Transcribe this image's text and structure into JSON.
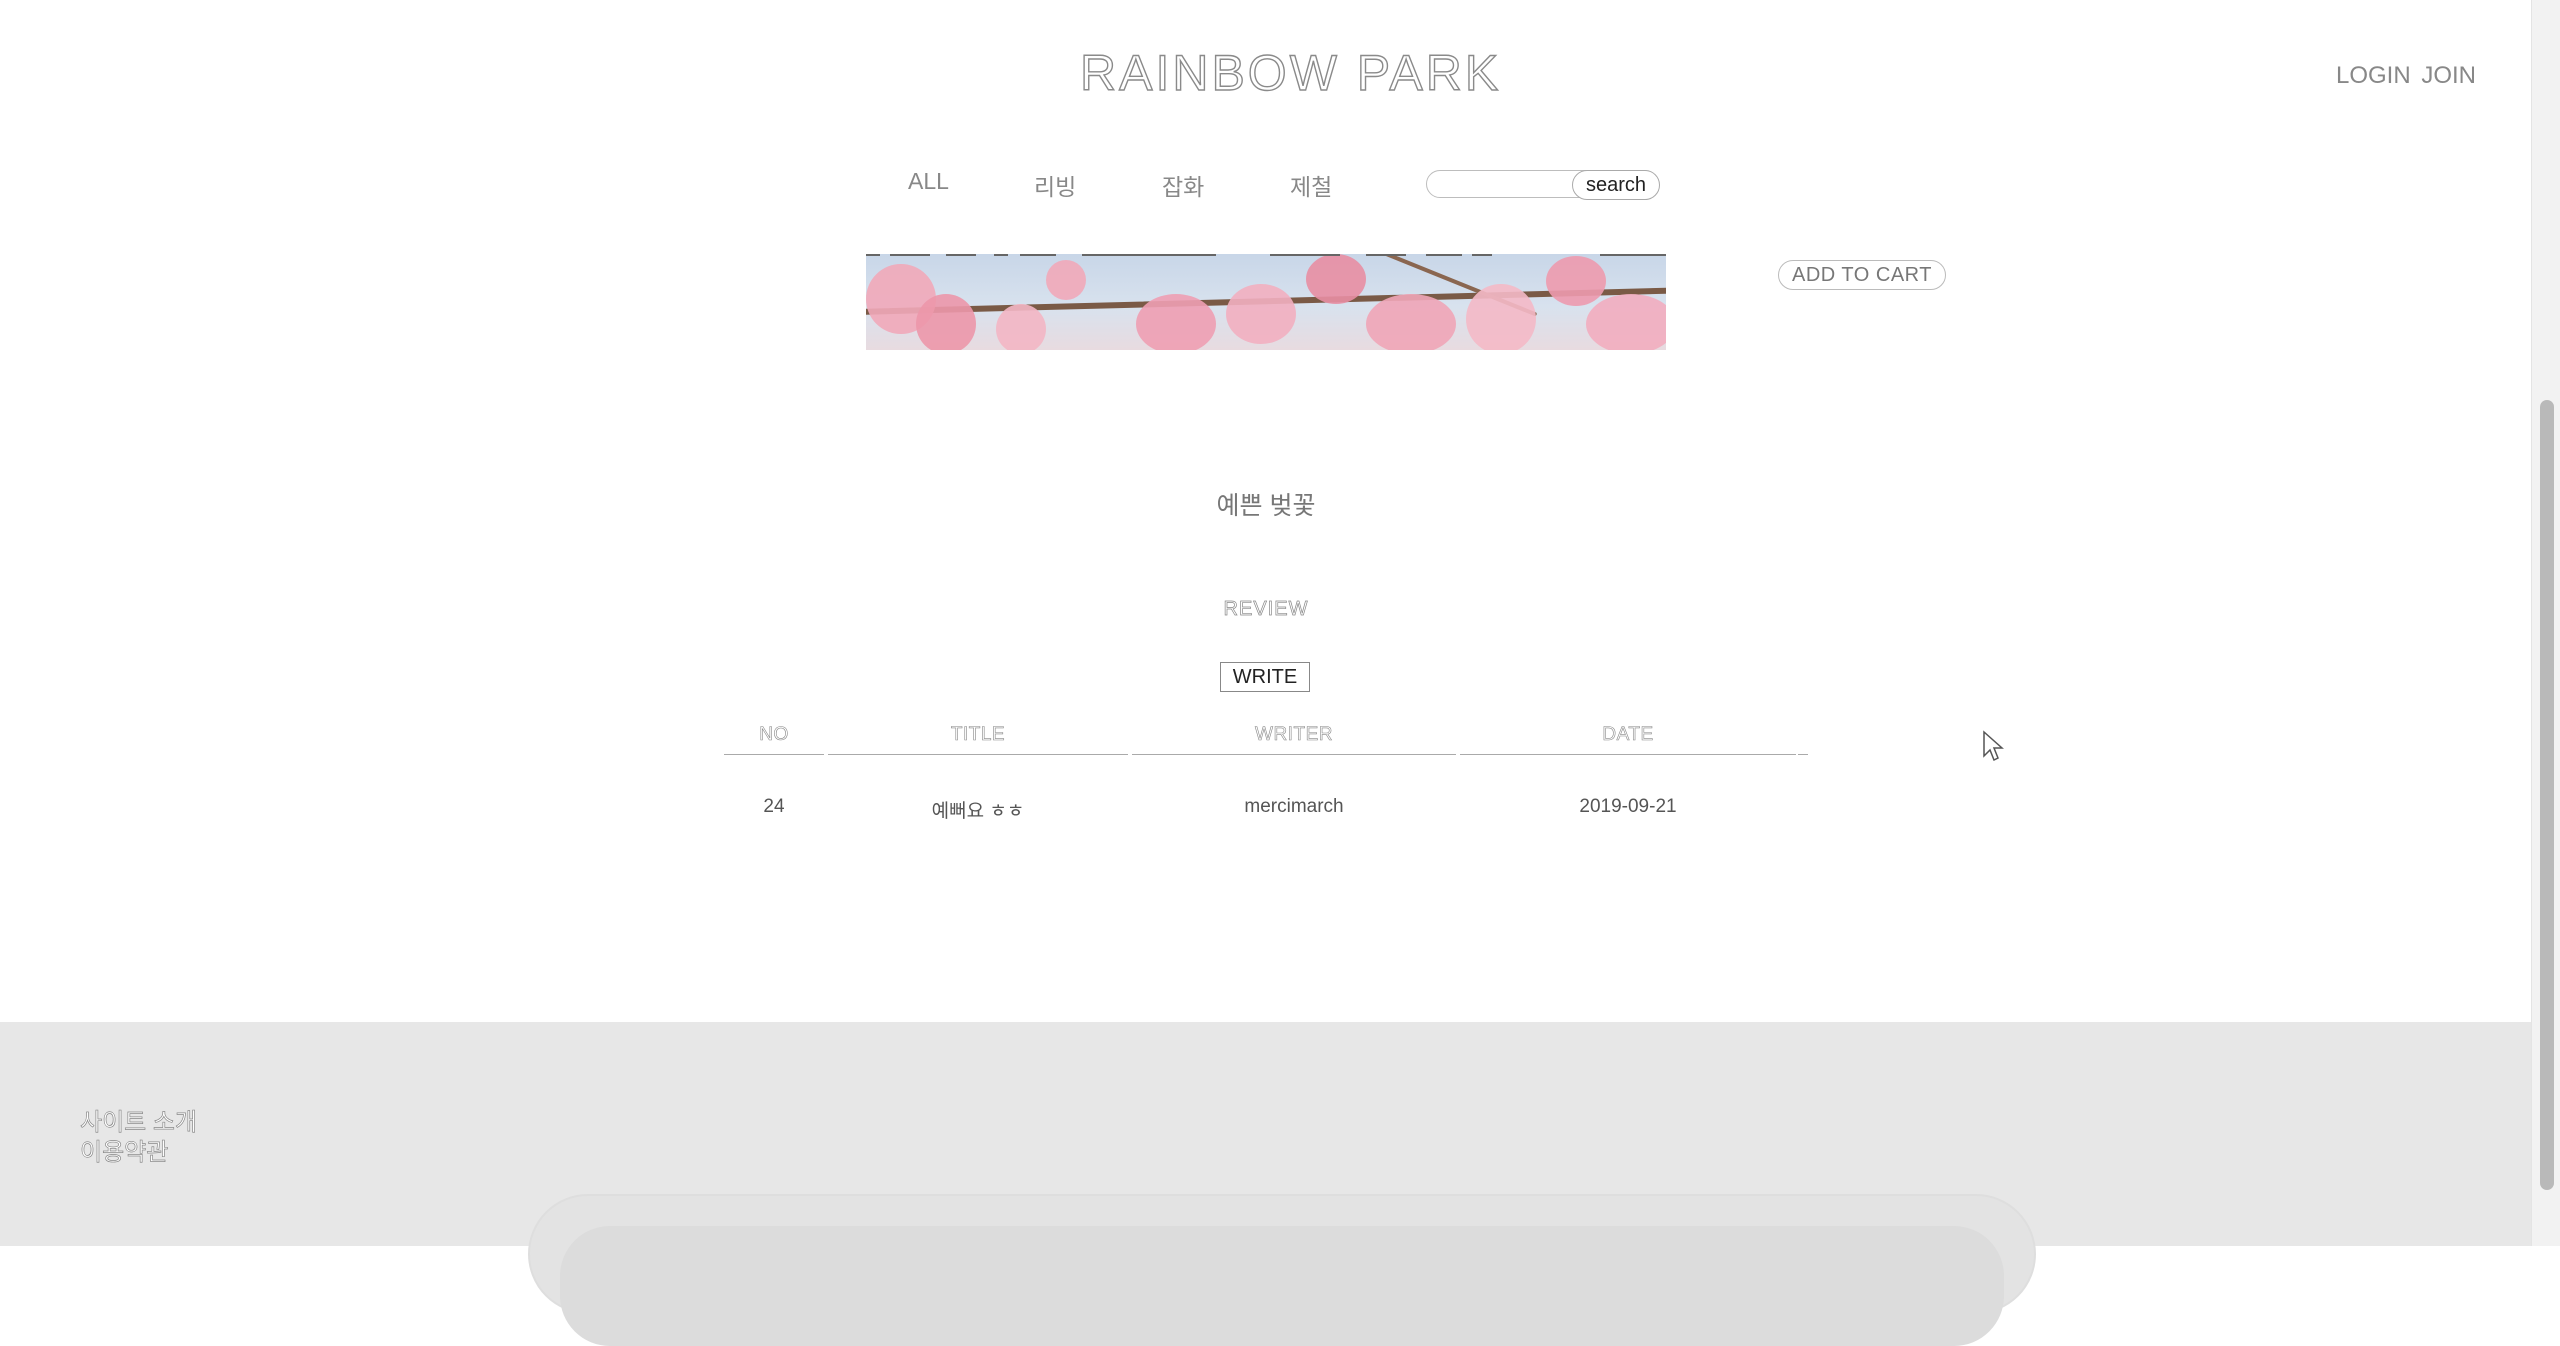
{
  "header": {
    "logo": "RAINBOW PARK",
    "login": "LOGIN",
    "join": "JOIN"
  },
  "nav": {
    "items": [
      {
        "label": "ALL"
      },
      {
        "label": "리빙"
      },
      {
        "label": "잡화"
      },
      {
        "label": "제철"
      }
    ],
    "search": {
      "value": "",
      "placeholder": "",
      "button_label": "search"
    }
  },
  "product": {
    "add_to_cart_label": "ADD TO CART",
    "name": "예쁜 벚꽃"
  },
  "review": {
    "title": "REVIEW",
    "write_label": "WRITE",
    "columns": [
      "NO",
      "TITLE",
      "WRITER",
      "DATE"
    ],
    "rows": [
      {
        "no": "24",
        "title": "예뻐요 ㅎㅎ",
        "writer": "mercimarch",
        "date": "2019-09-21"
      }
    ]
  },
  "footer": {
    "links": [
      "사이트 소개",
      "이용약관"
    ]
  },
  "colors": {
    "footer_bg": "#e7e7e7",
    "text_gray": "#777777"
  }
}
